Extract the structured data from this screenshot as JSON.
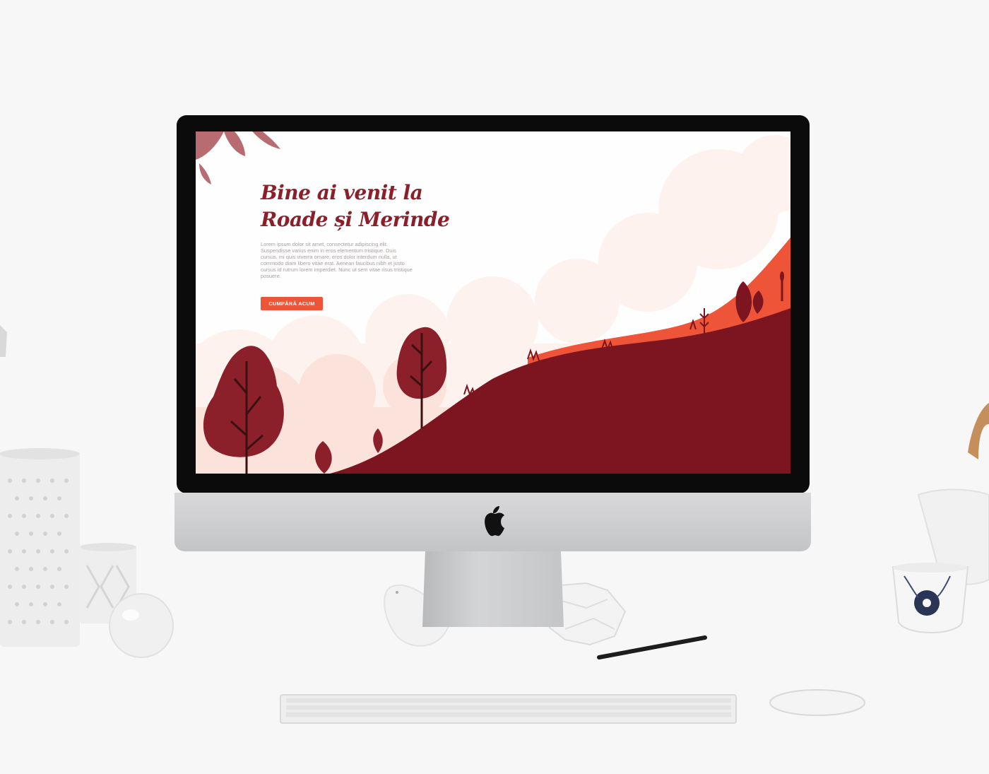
{
  "site": {
    "hero_title_line1": "Bine ai venit la",
    "hero_title_line2": "Roade și Merinde",
    "hero_text": "Lorem ipsum dolor sit amet, consectetur adipiscing elit. Suspendisse varius enim in eros elementum tristique. Duis cursus, mi quis viverra ornare, eros dolor interdum nulla, ut commodo diam libero vitae erat. Aenean faucibus nibh et justo cursus id rutrum lorem imperdiet. Nunc ut sem vitae risus tristique posuere.",
    "cta_label": "CUMPĂRĂ ACUM"
  },
  "colors": {
    "brand_dark_red": "#8b1f2a",
    "accent_orange": "#ee5437",
    "hill_dark": "#7d1520",
    "cloud_pink": "#fbe3dc"
  },
  "icons": [
    "apple-logo-icon",
    "leaf-icon",
    "tree-icon"
  ]
}
